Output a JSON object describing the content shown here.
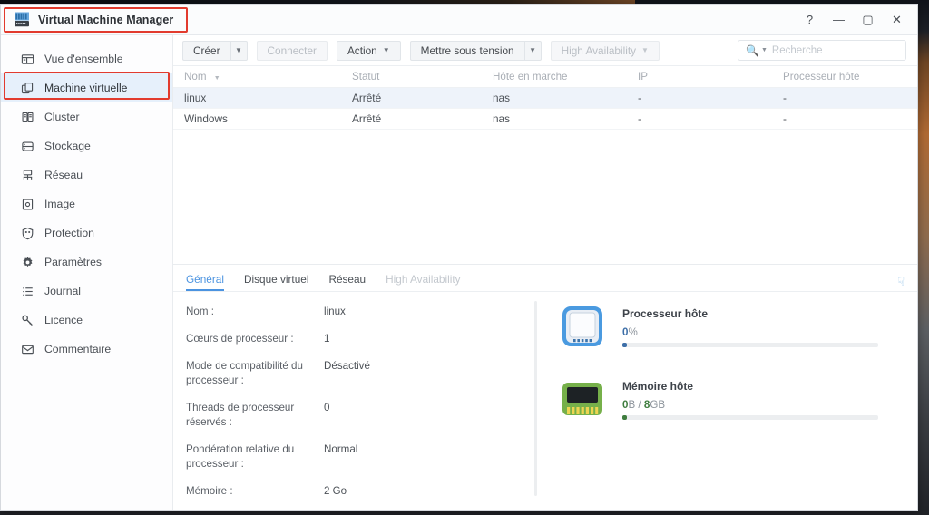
{
  "window": {
    "title": "Virtual Machine Manager",
    "app_icon": "server-rack-icon",
    "controls": {
      "help": "?",
      "minimize": "—",
      "maximize": "▢",
      "close": "✕"
    }
  },
  "sidebar": {
    "items": [
      {
        "label": "Vue d'ensemble",
        "icon": "dashboard-icon",
        "active": false
      },
      {
        "label": "Machine virtuelle",
        "icon": "copy-windows-icon",
        "active": true
      },
      {
        "label": "Cluster",
        "icon": "cluster-icon",
        "active": false
      },
      {
        "label": "Stockage",
        "icon": "database-icon",
        "active": false
      },
      {
        "label": "Réseau",
        "icon": "network-icon",
        "active": false
      },
      {
        "label": "Image",
        "icon": "image-icon",
        "active": false
      },
      {
        "label": "Protection",
        "icon": "shield-icon",
        "active": false
      },
      {
        "label": "Paramètres",
        "icon": "gear-icon",
        "active": false
      },
      {
        "label": "Journal",
        "icon": "list-icon",
        "active": false
      },
      {
        "label": "Licence",
        "icon": "key-icon",
        "active": false
      },
      {
        "label": "Commentaire",
        "icon": "envelope-icon",
        "active": false
      }
    ]
  },
  "toolbar": {
    "create_label": "Créer",
    "connect_label": "Connecter",
    "action_label": "Action",
    "power_on_label": "Mettre sous tension",
    "high_availability_label": "High Availability"
  },
  "search": {
    "placeholder": "Recherche",
    "value": "",
    "icon": "search-icon"
  },
  "table": {
    "columns": [
      "Nom",
      "Statut",
      "Hôte en marche",
      "IP",
      "Processeur hôte"
    ],
    "sorted_column": "Nom",
    "rows": [
      {
        "nom": "linux",
        "statut": "Arrêté",
        "hote": "nas",
        "ip": "-",
        "processeur": "-",
        "selected": true
      },
      {
        "nom": "Windows",
        "statut": "Arrêté",
        "hote": "nas",
        "ip": "-",
        "processeur": "-",
        "selected": false
      }
    ],
    "more_icon": "kebab-menu-icon"
  },
  "detail": {
    "tabs": [
      {
        "label": "Général",
        "active": true,
        "disabled": false
      },
      {
        "label": "Disque virtuel",
        "active": false,
        "disabled": false
      },
      {
        "label": "Réseau",
        "active": false,
        "disabled": false
      },
      {
        "label": "High Availability",
        "active": false,
        "disabled": true
      }
    ],
    "expand_icon": "chevron-double-down-icon",
    "properties": [
      {
        "key": "Nom :",
        "value": "linux"
      },
      {
        "key": "Cœurs de processeur :",
        "value": "1"
      },
      {
        "key": "Mode de compatibilité du processeur :",
        "value": "Désactivé"
      },
      {
        "key": "Threads de processeur réservés :",
        "value": "0"
      },
      {
        "key": "Pondération relative du processeur :",
        "value": "Normal"
      },
      {
        "key": "Mémoire :",
        "value": "2 Go"
      }
    ],
    "gauges": [
      {
        "title": "Processeur hôte",
        "icon": "cpu-chip-icon",
        "value_num": "0",
        "value_unit": "%",
        "separator": "",
        "total_num": "",
        "total_unit": "",
        "percent": 0,
        "color": "#3d6fa8"
      },
      {
        "title": "Mémoire hôte",
        "icon": "memory-module-icon",
        "value_num": "0",
        "value_unit": "B",
        "separator": "/",
        "total_num": "8",
        "total_unit": "GB",
        "percent": 0,
        "color": "#3f7d3f"
      }
    ]
  },
  "annotations": {
    "title_box_color": "#e23b2e",
    "nav_box_color": "#e23b2e"
  }
}
